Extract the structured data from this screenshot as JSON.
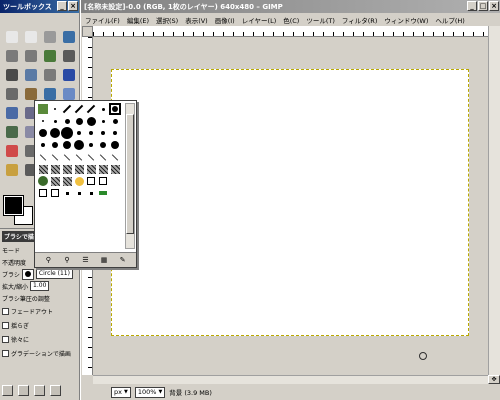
{
  "toolbox": {
    "title": "ツールボックス",
    "tools": [
      {
        "name": "rect-select-icon",
        "color": "#e8e8e8"
      },
      {
        "name": "ellipse-select-icon",
        "color": "#e8e8e8"
      },
      {
        "name": "free-select-icon",
        "color": "#9a9a9a"
      },
      {
        "name": "fuzzy-select-icon",
        "color": "#3a6ea5"
      },
      {
        "name": "color-select-icon",
        "color": "#7a7a7a"
      },
      {
        "name": "scissors-icon",
        "color": "#7a7a7a"
      },
      {
        "name": "foreground-select-icon",
        "color": "#4a7a3a"
      },
      {
        "name": "paths-icon",
        "color": "#5a5a5a"
      },
      {
        "name": "color-picker-icon",
        "color": "#4a4a4a"
      },
      {
        "name": "zoom-icon",
        "color": "#5a7aa5"
      },
      {
        "name": "measure-icon",
        "color": "#7a7a7a"
      },
      {
        "name": "move-icon",
        "color": "#2a4aa5"
      },
      {
        "name": "align-icon",
        "color": "#6a6a6a"
      },
      {
        "name": "crop-icon",
        "color": "#8a6a3a"
      },
      {
        "name": "rotate-icon",
        "color": "#3a6ea5"
      },
      {
        "name": "scale-icon",
        "color": "#6a8ac5"
      },
      {
        "name": "shear-icon",
        "color": "#4a6aa5"
      },
      {
        "name": "perspective-icon",
        "color": "#6a6a8a"
      },
      {
        "name": "flip-icon",
        "color": "#3a5a95"
      },
      {
        "name": "text-icon",
        "color": "#1a1a1a"
      },
      {
        "name": "bucket-fill-icon",
        "color": "#4a6a4a"
      },
      {
        "name": "blend-icon",
        "color": "#8a8aa5"
      },
      {
        "name": "pencil-icon",
        "color": "#3a3a3a"
      },
      {
        "name": "paintbrush-icon",
        "color": "#3a3a3a"
      },
      {
        "name": "eraser-icon",
        "color": "#d04a4a"
      },
      {
        "name": "airbrush-icon",
        "color": "#6a6a6a"
      },
      {
        "name": "ink-icon",
        "color": "#2a2a2a"
      },
      {
        "name": "clone-icon",
        "color": "#8a7a5a"
      },
      {
        "name": "heal-icon",
        "color": "#c8a040"
      },
      {
        "name": "perspective-clone-icon",
        "color": "#5a5a5a"
      },
      {
        "name": "smudge-icon",
        "color": "#7a7a7a"
      },
      {
        "name": "dodge-burn-icon",
        "color": "#1a1a1a"
      }
    ],
    "options": {
      "title": "ブラシで描画",
      "mode_label": "モード",
      "opacity_label": "不透明度",
      "brush_label": "ブラシ",
      "brush_value": "Circle (11)",
      "scale_label": "拡大/縮小",
      "scale_value": "1.00",
      "fade_opt": "ブラシ筆圧の調整",
      "checkboxes": [
        "フェードアウト",
        "揺らぎ",
        "徐々に",
        "グラデーションで描画"
      ]
    }
  },
  "image_window": {
    "title": "[名称未設定]-0.0 (RGB, 1枚のレイヤー) 640x480 – GIMP",
    "menu": [
      "ファイル(F)",
      "編集(E)",
      "選択(S)",
      "表示(V)",
      "画像(I)",
      "レイヤー(L)",
      "色(C)",
      "ツール(T)",
      "フィルタ(R)",
      "ウィンドウ(W)",
      "ヘルプ(H)"
    ],
    "status": {
      "unit": "px",
      "zoom": "100%",
      "text": "背景 (3.9 MB)"
    }
  }
}
